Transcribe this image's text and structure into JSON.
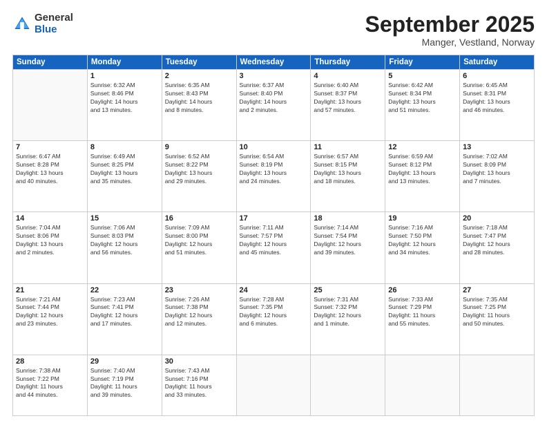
{
  "logo": {
    "general": "General",
    "blue": "Blue"
  },
  "header": {
    "month": "September 2025",
    "location": "Manger, Vestland, Norway"
  },
  "weekdays": [
    "Sunday",
    "Monday",
    "Tuesday",
    "Wednesday",
    "Thursday",
    "Friday",
    "Saturday"
  ],
  "weeks": [
    [
      {
        "day": "",
        "info": ""
      },
      {
        "day": "1",
        "info": "Sunrise: 6:32 AM\nSunset: 8:46 PM\nDaylight: 14 hours\nand 13 minutes."
      },
      {
        "day": "2",
        "info": "Sunrise: 6:35 AM\nSunset: 8:43 PM\nDaylight: 14 hours\nand 8 minutes."
      },
      {
        "day": "3",
        "info": "Sunrise: 6:37 AM\nSunset: 8:40 PM\nDaylight: 14 hours\nand 2 minutes."
      },
      {
        "day": "4",
        "info": "Sunrise: 6:40 AM\nSunset: 8:37 PM\nDaylight: 13 hours\nand 57 minutes."
      },
      {
        "day": "5",
        "info": "Sunrise: 6:42 AM\nSunset: 8:34 PM\nDaylight: 13 hours\nand 51 minutes."
      },
      {
        "day": "6",
        "info": "Sunrise: 6:45 AM\nSunset: 8:31 PM\nDaylight: 13 hours\nand 46 minutes."
      }
    ],
    [
      {
        "day": "7",
        "info": "Sunrise: 6:47 AM\nSunset: 8:28 PM\nDaylight: 13 hours\nand 40 minutes."
      },
      {
        "day": "8",
        "info": "Sunrise: 6:49 AM\nSunset: 8:25 PM\nDaylight: 13 hours\nand 35 minutes."
      },
      {
        "day": "9",
        "info": "Sunrise: 6:52 AM\nSunset: 8:22 PM\nDaylight: 13 hours\nand 29 minutes."
      },
      {
        "day": "10",
        "info": "Sunrise: 6:54 AM\nSunset: 8:19 PM\nDaylight: 13 hours\nand 24 minutes."
      },
      {
        "day": "11",
        "info": "Sunrise: 6:57 AM\nSunset: 8:15 PM\nDaylight: 13 hours\nand 18 minutes."
      },
      {
        "day": "12",
        "info": "Sunrise: 6:59 AM\nSunset: 8:12 PM\nDaylight: 13 hours\nand 13 minutes."
      },
      {
        "day": "13",
        "info": "Sunrise: 7:02 AM\nSunset: 8:09 PM\nDaylight: 13 hours\nand 7 minutes."
      }
    ],
    [
      {
        "day": "14",
        "info": "Sunrise: 7:04 AM\nSunset: 8:06 PM\nDaylight: 13 hours\nand 2 minutes."
      },
      {
        "day": "15",
        "info": "Sunrise: 7:06 AM\nSunset: 8:03 PM\nDaylight: 12 hours\nand 56 minutes."
      },
      {
        "day": "16",
        "info": "Sunrise: 7:09 AM\nSunset: 8:00 PM\nDaylight: 12 hours\nand 51 minutes."
      },
      {
        "day": "17",
        "info": "Sunrise: 7:11 AM\nSunset: 7:57 PM\nDaylight: 12 hours\nand 45 minutes."
      },
      {
        "day": "18",
        "info": "Sunrise: 7:14 AM\nSunset: 7:54 PM\nDaylight: 12 hours\nand 39 minutes."
      },
      {
        "day": "19",
        "info": "Sunrise: 7:16 AM\nSunset: 7:50 PM\nDaylight: 12 hours\nand 34 minutes."
      },
      {
        "day": "20",
        "info": "Sunrise: 7:18 AM\nSunset: 7:47 PM\nDaylight: 12 hours\nand 28 minutes."
      }
    ],
    [
      {
        "day": "21",
        "info": "Sunrise: 7:21 AM\nSunset: 7:44 PM\nDaylight: 12 hours\nand 23 minutes."
      },
      {
        "day": "22",
        "info": "Sunrise: 7:23 AM\nSunset: 7:41 PM\nDaylight: 12 hours\nand 17 minutes."
      },
      {
        "day": "23",
        "info": "Sunrise: 7:26 AM\nSunset: 7:38 PM\nDaylight: 12 hours\nand 12 minutes."
      },
      {
        "day": "24",
        "info": "Sunrise: 7:28 AM\nSunset: 7:35 PM\nDaylight: 12 hours\nand 6 minutes."
      },
      {
        "day": "25",
        "info": "Sunrise: 7:31 AM\nSunset: 7:32 PM\nDaylight: 12 hours\nand 1 minute."
      },
      {
        "day": "26",
        "info": "Sunrise: 7:33 AM\nSunset: 7:29 PM\nDaylight: 11 hours\nand 55 minutes."
      },
      {
        "day": "27",
        "info": "Sunrise: 7:35 AM\nSunset: 7:25 PM\nDaylight: 11 hours\nand 50 minutes."
      }
    ],
    [
      {
        "day": "28",
        "info": "Sunrise: 7:38 AM\nSunset: 7:22 PM\nDaylight: 11 hours\nand 44 minutes."
      },
      {
        "day": "29",
        "info": "Sunrise: 7:40 AM\nSunset: 7:19 PM\nDaylight: 11 hours\nand 39 minutes."
      },
      {
        "day": "30",
        "info": "Sunrise: 7:43 AM\nSunset: 7:16 PM\nDaylight: 11 hours\nand 33 minutes."
      },
      {
        "day": "",
        "info": ""
      },
      {
        "day": "",
        "info": ""
      },
      {
        "day": "",
        "info": ""
      },
      {
        "day": "",
        "info": ""
      }
    ]
  ]
}
